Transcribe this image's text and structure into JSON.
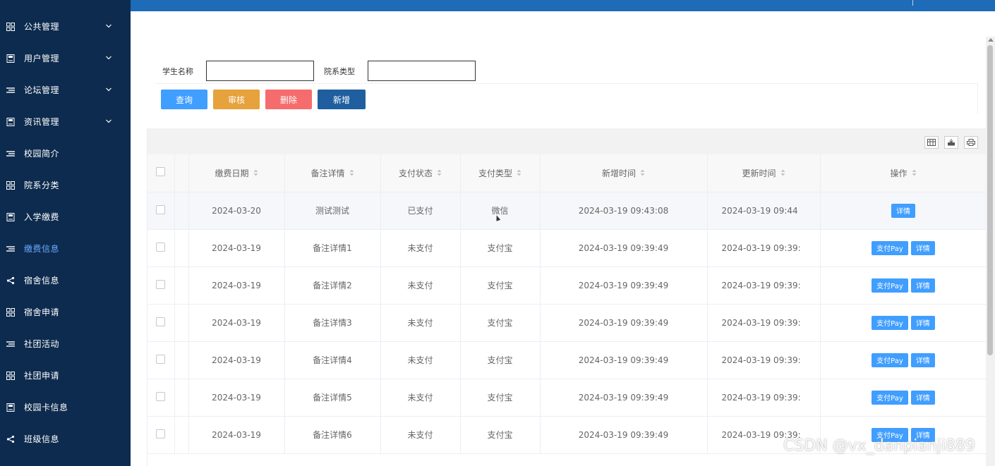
{
  "sidebar": {
    "items": [
      {
        "label": "公共管理",
        "icon": "grid-icon",
        "has_arrow": true
      },
      {
        "label": "用户管理",
        "icon": "book-icon",
        "has_arrow": true
      },
      {
        "label": "论坛管理",
        "icon": "list-icon",
        "has_arrow": true
      },
      {
        "label": "资讯管理",
        "icon": "book-icon",
        "has_arrow": true
      },
      {
        "label": "校园简介",
        "icon": "list-icon",
        "has_arrow": false
      },
      {
        "label": "院系分类",
        "icon": "grid-icon",
        "has_arrow": false
      },
      {
        "label": "入学缴费",
        "icon": "book-icon",
        "has_arrow": false
      },
      {
        "label": "缴费信息",
        "icon": "list-icon",
        "has_arrow": false,
        "active": true
      },
      {
        "label": "宿舍信息",
        "icon": "share-icon",
        "has_arrow": false
      },
      {
        "label": "宿舍申请",
        "icon": "grid-icon",
        "has_arrow": false
      },
      {
        "label": "社团活动",
        "icon": "list-icon",
        "has_arrow": false
      },
      {
        "label": "社团申请",
        "icon": "grid-icon",
        "has_arrow": false
      },
      {
        "label": "校园卡信息",
        "icon": "book-icon",
        "has_arrow": false
      },
      {
        "label": "班级信息",
        "icon": "share-icon",
        "has_arrow": false
      }
    ]
  },
  "search": {
    "field1_label": "学生名称",
    "field1_value": "",
    "field2_label": "院系类型",
    "field2_value": ""
  },
  "buttons": {
    "query": "查询",
    "audit": "审核",
    "delete": "删除",
    "add": "新增"
  },
  "table": {
    "columns": [
      "缴费日期",
      "备注详情",
      "支付状态",
      "支付类型",
      "新增时间",
      "更新时间",
      "操作"
    ],
    "rows": [
      {
        "date": "2024-03-20",
        "remark": "测试测试",
        "status": "已支付",
        "type": "微信",
        "created": "2024-03-19 09:43:08",
        "updated": "2024-03-19 09:44",
        "actions": [
          "详情"
        ]
      },
      {
        "date": "2024-03-19",
        "remark": "备注详情1",
        "status": "未支付",
        "type": "支付宝",
        "created": "2024-03-19 09:39:49",
        "updated": "2024-03-19 09:39:",
        "actions": [
          "支付Pay",
          "详情"
        ]
      },
      {
        "date": "2024-03-19",
        "remark": "备注详情2",
        "status": "未支付",
        "type": "支付宝",
        "created": "2024-03-19 09:39:49",
        "updated": "2024-03-19 09:39:",
        "actions": [
          "支付Pay",
          "详情"
        ]
      },
      {
        "date": "2024-03-19",
        "remark": "备注详情3",
        "status": "未支付",
        "type": "支付宝",
        "created": "2024-03-19 09:39:49",
        "updated": "2024-03-19 09:39:",
        "actions": [
          "支付Pay",
          "详情"
        ]
      },
      {
        "date": "2024-03-19",
        "remark": "备注详情4",
        "status": "未支付",
        "type": "支付宝",
        "created": "2024-03-19 09:39:49",
        "updated": "2024-03-19 09:39:",
        "actions": [
          "支付Pay",
          "详情"
        ]
      },
      {
        "date": "2024-03-19",
        "remark": "备注详情5",
        "status": "未支付",
        "type": "支付宝",
        "created": "2024-03-19 09:39:49",
        "updated": "2024-03-19 09:39:",
        "actions": [
          "支付Pay",
          "详情"
        ]
      },
      {
        "date": "2024-03-19",
        "remark": "备注详情6",
        "status": "未支付",
        "type": "支付宝",
        "created": "2024-03-19 09:39:49",
        "updated": "2024-03-19 09:39:",
        "actions": [
          "支付Pay",
          "详情"
        ]
      }
    ]
  },
  "watermark": "CSDN @vx_danpianji889",
  "colors": {
    "sidebar_bg": "#0d2b4e",
    "topbar": "#1e6bb8",
    "primary": "#409eff",
    "warning": "#e6a23c",
    "danger": "#f56c6c",
    "add": "#1f5fa0",
    "active_menu": "#6aa9ff"
  }
}
